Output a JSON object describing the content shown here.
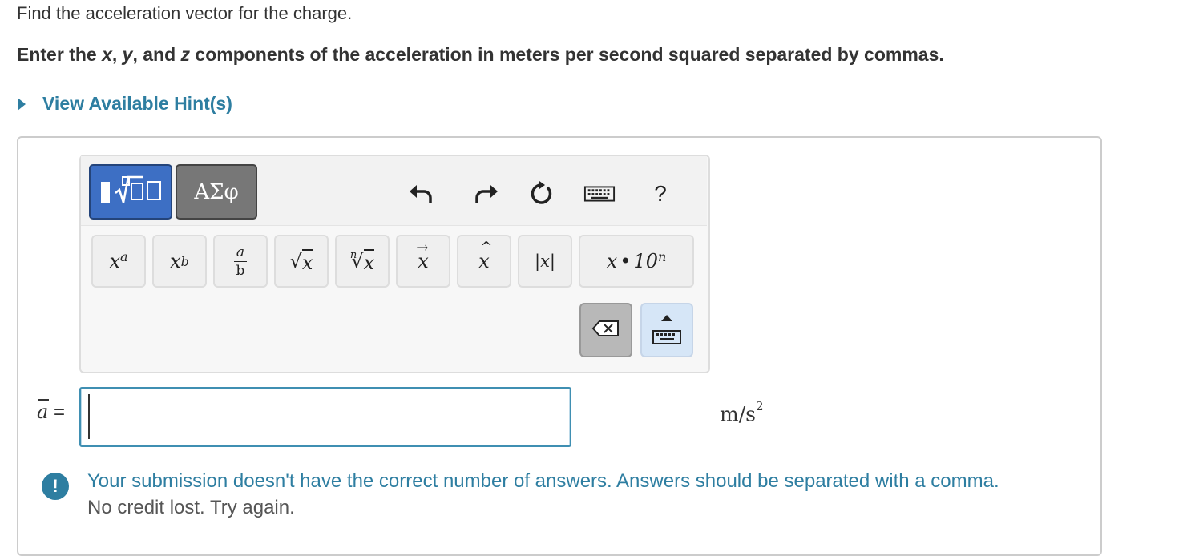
{
  "question": {
    "prompt": "Find the acceleration vector for the charge.",
    "instruction_pre": "Enter the ",
    "instruction_x": "x",
    "instruction_comma1": ", ",
    "instruction_y": "y",
    "instruction_and": ", and ",
    "instruction_z": "z",
    "instruction_post": " components of the acceleration in meters per second squared separated by commas."
  },
  "hint": {
    "label": "View Available Hint(s)"
  },
  "toolbar": {
    "greek_tab_label": "ΑΣφ",
    "help_label": "?",
    "icons": [
      "templates-icon",
      "undo-icon",
      "redo-icon",
      "reset-icon",
      "keyboard-icon",
      "help-icon"
    ]
  },
  "keypad": {
    "power": {
      "base": "x",
      "exp": "a"
    },
    "subscript": {
      "base": "x",
      "sub": "b"
    },
    "fraction": {
      "num": "a",
      "den": "b"
    },
    "sqrt": {
      "radicand": "x"
    },
    "nthroot": {
      "index": "n",
      "radicand": "x"
    },
    "vector": {
      "base": "x"
    },
    "unitvec": {
      "base": "x"
    },
    "abs": {
      "label": "|x|"
    },
    "sci": {
      "base": "x",
      "dot": "•",
      "ten": "10",
      "exp": "n"
    }
  },
  "answer": {
    "label_var": "a",
    "label_eq": " =",
    "value": "",
    "unit_base": "m/s",
    "unit_exp": "2"
  },
  "feedback": {
    "icon": "!",
    "message": "Your submission doesn't have the correct number of answers. Answers should be separated with a comma.",
    "note": "No credit lost. Try again.",
    "color": "#2e7ea1"
  }
}
